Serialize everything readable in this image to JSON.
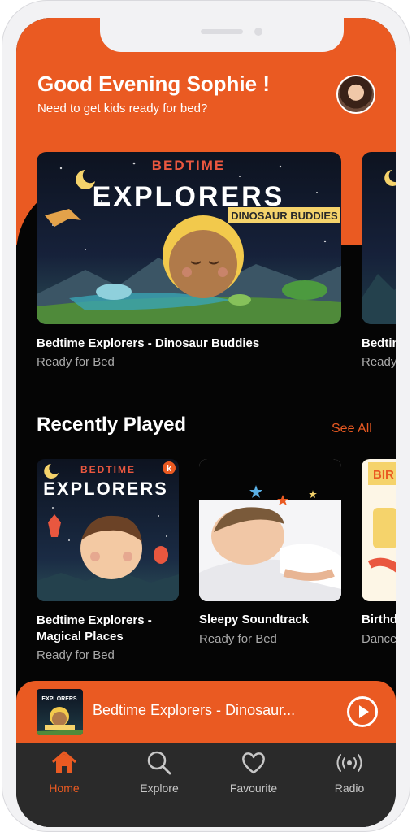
{
  "header": {
    "greeting": "Good Evening Sophie !",
    "subtitle": "Need to get kids ready for bed?"
  },
  "featured": [
    {
      "title": "Bedtime Explorers - Dinosaur Buddies",
      "subtitle": "Ready for Bed",
      "art": {
        "brand": "BEDTIME",
        "series": "EXPLORERS",
        "badge": "DINOSAUR BUDDIES"
      }
    },
    {
      "title": "Bedtime Explorers",
      "subtitle": "Ready for Bed"
    }
  ],
  "recent": {
    "title": "Recently Played",
    "see_all": "See All",
    "items": [
      {
        "title": "Bedtime Explorers - Magical Places",
        "subtitle": "Ready for Bed",
        "art": {
          "brand": "BEDTIME",
          "series": "EXPLORERS",
          "corner": "k"
        }
      },
      {
        "title": "Sleepy Soundtrack",
        "subtitle": "Ready for Bed"
      },
      {
        "title": "Birthday",
        "subtitle": "Dance",
        "art": {
          "banner": "BIR"
        }
      }
    ]
  },
  "player": {
    "title": "Bedtime Explorers - Dinosaur...",
    "art_text": "EXPLORERS"
  },
  "nav": [
    {
      "label": "Home",
      "icon": "home-icon",
      "active": true
    },
    {
      "label": "Explore",
      "icon": "search-icon",
      "active": false
    },
    {
      "label": "Favourite",
      "icon": "heart-icon",
      "active": false
    },
    {
      "label": "Radio",
      "icon": "radio-icon",
      "active": false
    }
  ],
  "colors": {
    "accent": "#ea5a22",
    "background": "#050505",
    "nav": "#2a2a2a"
  }
}
